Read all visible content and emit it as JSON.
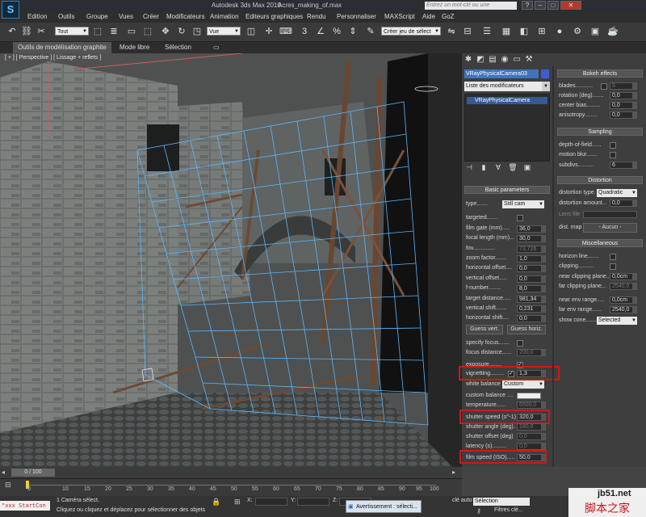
{
  "titlebar": {
    "logo": "S",
    "app_title": "Autodesk 3ds Max  2010",
    "file_name": "Acres_making_of.max",
    "search_placeholder": "Entrez un mot-clé ou une expression",
    "buttons": [
      "?",
      "–",
      "□",
      "✕"
    ]
  },
  "menu": [
    "Edition",
    "Outils",
    "Groupe",
    "Vues",
    "Créer",
    "Modificateurs",
    "Animation",
    "Editeurs graphiques",
    "Rendu",
    "Personnaliser",
    "MAXScript",
    "Aide",
    "GoZ"
  ],
  "toolbar": {
    "selection_filter": "Tout",
    "reference_coord": "Vue",
    "named_selection": "Créer jeu de sélect"
  },
  "ribbon": {
    "tabs": [
      "Outils de modélisation graphite",
      "Mode libre",
      "Sélection"
    ]
  },
  "viewport": {
    "label": "[ + ] [ Perspective ] [ Lissage + reflets ]"
  },
  "command_panel": {
    "object_name": "VRayPhysicalCamera03",
    "object_color": "#3b5dd4",
    "modifier_list_label": "Liste des modificateurs",
    "stack_item": "VRayPhysicalCamera",
    "basic": {
      "header": "Basic parameters",
      "type_label": "type.......",
      "type_value": "Still cam",
      "targeted": "targeted.......",
      "film_gate": "film gate (mm).....",
      "film_gate_value": "36,0",
      "focal_length": "focal length (mm)...",
      "focal_length_value": "30,0",
      "fov": "fov..............",
      "fov_value": "73,726",
      "zoom_factor": "zoom factor.......",
      "zoom_factor_value": "1,0",
      "horizontal_offset": "horizontal offset....",
      "horizontal_offset_value": "0,0",
      "vertical_offset": "vertical offset.....",
      "vertical_offset_value": "0,0",
      "f_number": "f-number........",
      "f_number_value": "8,0",
      "target_distance": "target distance.....",
      "target_distance_value": "981,34",
      "vertical_shift": "vertical shift.......",
      "vertical_shift_value": "0,231",
      "horizontal_shift": "horizontal shift....",
      "horizontal_shift_value": "0,0",
      "guess_vert": "Guess vert.",
      "guess_horiz": "Guess horiz.",
      "specify_focus": "specify focus.......",
      "focus_distance": "focus distance......",
      "focus_distance_value": "200,0",
      "exposure": "exposure........",
      "vignetting": "vignetting.........",
      "vignetting_value": "1,3",
      "white_balance": "white balance",
      "white_balance_value": "Custom",
      "custom_balance": "custom balance ....",
      "temperature": "temperature......",
      "temperature_value": "6500,0",
      "shutter_speed": "shutter speed (s^-1)",
      "shutter_speed_value": "320,0",
      "shutter_angle": "shutter angle (deg).",
      "shutter_angle_value": "180,0",
      "shutter_offset": "shutter offset (deg)",
      "shutter_offset_value": "0,0",
      "latency": "latency (s).........",
      "latency_value": "0,0",
      "film_speed": "film speed (ISO).....",
      "film_speed_value": "50,0"
    },
    "bokeh": {
      "header": "Bokeh effects",
      "blades": "blades...........",
      "blades_value": "5",
      "rotation": "rotation (deg).......",
      "rotation_value": "0,0",
      "center_bias": "center bias.........",
      "center_bias_value": "0,0",
      "anisotropy": "anisotropy........",
      "anisotropy_value": "0,0"
    },
    "sampling": {
      "header": "Sampling",
      "depth_of_field": "depth-of-field......",
      "motion_blur": "motion blur.......",
      "subdivs": "subdivs..........",
      "subdivs_value": "6"
    },
    "distortion": {
      "header": "Distortion",
      "distortion_type": "distortion type.",
      "distortion_type_value": "Quadratic",
      "distortion_amount": "distortion amount...",
      "distortion_amount_value": "0,0",
      "lens_file": "Lens file",
      "dist_map": "dist. map",
      "dist_map_value": "Aucun"
    },
    "misc": {
      "header": "Miscellaneous",
      "horizon_line": "horizon line.......",
      "clipping": "clipping..........",
      "near_clipping": "near clipping plane..",
      "near_clipping_value": "0,0cm",
      "far_clipping": "far clipping plane...",
      "far_clipping_value": "2540,0",
      "near_env": "near env range.....",
      "near_env_value": "0,0cm",
      "far_env": "far env range......",
      "far_env_value": "2540,0",
      "show_cone": "show cone.......",
      "show_cone_value": "Selected"
    }
  },
  "timeline": {
    "slider": "0 / 100",
    "ticks": [
      "0",
      "10",
      "15",
      "20",
      "25",
      "30",
      "35",
      "40",
      "45",
      "50",
      "55",
      "60",
      "65",
      "70",
      "75",
      "80",
      "85",
      "90",
      "95",
      "100"
    ]
  },
  "status": {
    "maxscript": "\"xxx StartCon",
    "message1": "1 Caméra sélect.",
    "message2": "Cliquez ou cliquez et déplacez pour sélectionner des objets",
    "task_button": "Avertissement : sélecti...",
    "auto_key": "clé auto",
    "selection_dropdown": "Sélection",
    "filters": "Filtres clé..."
  },
  "watermark": {
    "site": "jb51.net",
    "brand": "脚本之家"
  }
}
